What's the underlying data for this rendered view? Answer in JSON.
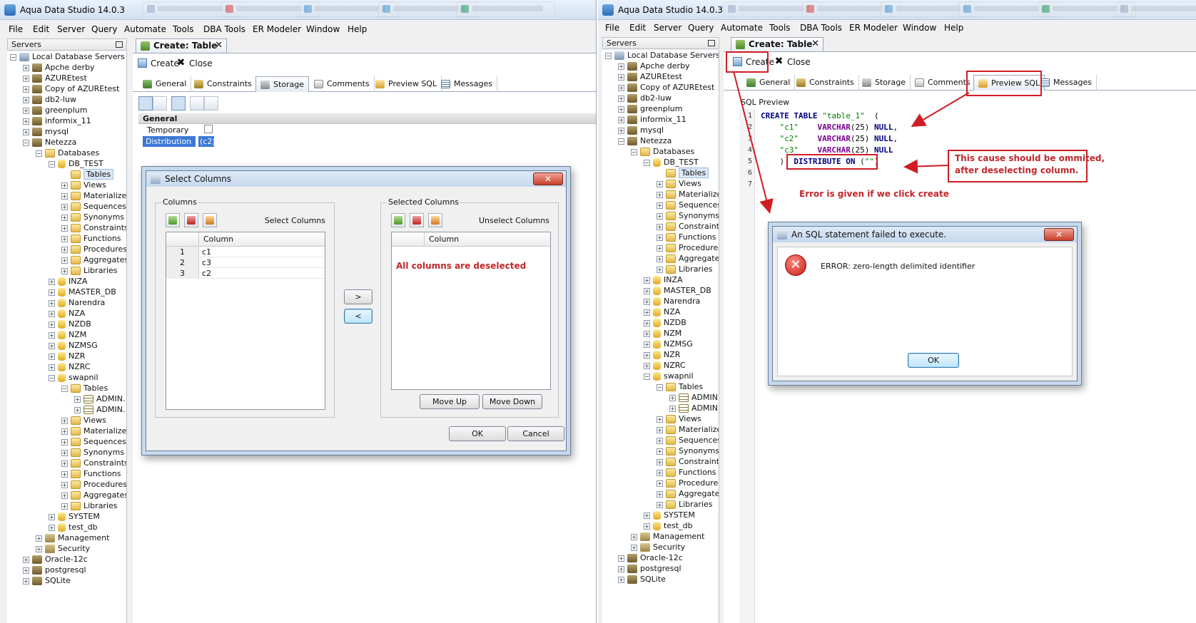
{
  "app_title": "Aqua Data Studio 14.0.3",
  "menu": [
    "File",
    "Edit",
    "Server",
    "Query",
    "Automate",
    "Tools",
    "DBA Tools",
    "ER Modeler",
    "Window",
    "Help"
  ],
  "servers_panel": {
    "title": "Servers"
  },
  "tree": {
    "left": [
      {
        "label": "Local Database Servers",
        "indent": 0,
        "exp": "-",
        "icon": "server-local"
      },
      {
        "label": "Apche derby",
        "indent": 1,
        "exp": "+",
        "icon": "server"
      },
      {
        "label": "AZUREtest",
        "indent": 1,
        "exp": "+",
        "icon": "server"
      },
      {
        "label": "Copy of AZUREtest",
        "indent": 1,
        "exp": "+",
        "icon": "server"
      },
      {
        "label": "db2-luw",
        "indent": 1,
        "exp": "+",
        "icon": "server"
      },
      {
        "label": "greenplum",
        "indent": 1,
        "exp": "+",
        "icon": "server"
      },
      {
        "label": "informix_11",
        "indent": 1,
        "exp": "+",
        "icon": "server"
      },
      {
        "label": "mysql",
        "indent": 1,
        "exp": "+",
        "icon": "server"
      },
      {
        "label": "Netezza",
        "indent": 1,
        "exp": "-",
        "icon": "server"
      },
      {
        "label": "Databases",
        "indent": 2,
        "exp": "-",
        "icon": "folder"
      },
      {
        "label": "DB_TEST",
        "indent": 3,
        "exp": "-",
        "icon": "db"
      },
      {
        "label": "Tables",
        "indent": 4,
        "exp": "",
        "icon": "folder",
        "selected": true
      },
      {
        "label": "Views",
        "indent": 4,
        "exp": "+",
        "icon": "folder"
      },
      {
        "label": "Materialized",
        "indent": 4,
        "exp": "+",
        "icon": "folder"
      },
      {
        "label": "Sequences",
        "indent": 4,
        "exp": "+",
        "icon": "folder"
      },
      {
        "label": "Synonyms",
        "indent": 4,
        "exp": "+",
        "icon": "folder"
      },
      {
        "label": "Constraints",
        "indent": 4,
        "exp": "+",
        "icon": "folder"
      },
      {
        "label": "Functions",
        "indent": 4,
        "exp": "+",
        "icon": "folder"
      },
      {
        "label": "Procedures",
        "indent": 4,
        "exp": "+",
        "icon": "folder"
      },
      {
        "label": "Aggregates",
        "indent": 4,
        "exp": "+",
        "icon": "folder"
      },
      {
        "label": "Libraries",
        "indent": 4,
        "exp": "+",
        "icon": "folder"
      },
      {
        "label": "INZA",
        "indent": 3,
        "exp": "+",
        "icon": "db"
      },
      {
        "label": "MASTER_DB",
        "indent": 3,
        "exp": "+",
        "icon": "db"
      },
      {
        "label": "Narendra",
        "indent": 3,
        "exp": "+",
        "icon": "db"
      },
      {
        "label": "NZA",
        "indent": 3,
        "exp": "+",
        "icon": "db"
      },
      {
        "label": "NZDB",
        "indent": 3,
        "exp": "+",
        "icon": "db"
      },
      {
        "label": "NZM",
        "indent": 3,
        "exp": "+",
        "icon": "db"
      },
      {
        "label": "NZMSG",
        "indent": 3,
        "exp": "+",
        "icon": "db"
      },
      {
        "label": "NZR",
        "indent": 3,
        "exp": "+",
        "icon": "db"
      },
      {
        "label": "NZRC",
        "indent": 3,
        "exp": "+",
        "icon": "db"
      },
      {
        "label": "swapnil",
        "indent": 3,
        "exp": "-",
        "icon": "db"
      },
      {
        "label": "Tables",
        "indent": 4,
        "exp": "-",
        "icon": "folder"
      },
      {
        "label": "ADMIN.",
        "indent": 5,
        "exp": "+",
        "icon": "table"
      },
      {
        "label": "ADMIN.",
        "indent": 5,
        "exp": "+",
        "icon": "table"
      },
      {
        "label": "Views",
        "indent": 4,
        "exp": "+",
        "icon": "folder"
      },
      {
        "label": "Materialized",
        "indent": 4,
        "exp": "+",
        "icon": "folder"
      },
      {
        "label": "Sequences",
        "indent": 4,
        "exp": "+",
        "icon": "folder"
      },
      {
        "label": "Synonyms",
        "indent": 4,
        "exp": "+",
        "icon": "folder"
      },
      {
        "label": "Constraints",
        "indent": 4,
        "exp": "+",
        "icon": "folder"
      },
      {
        "label": "Functions",
        "indent": 4,
        "exp": "+",
        "icon": "folder"
      },
      {
        "label": "Procedures",
        "indent": 4,
        "exp": "+",
        "icon": "folder"
      },
      {
        "label": "Aggregates",
        "indent": 4,
        "exp": "+",
        "icon": "folder"
      },
      {
        "label": "Libraries",
        "indent": 4,
        "exp": "+",
        "icon": "folder"
      },
      {
        "label": "SYSTEM",
        "indent": 3,
        "exp": "+",
        "icon": "db"
      },
      {
        "label": "test_db",
        "indent": 3,
        "exp": "+",
        "icon": "db"
      },
      {
        "label": "Management",
        "indent": 2,
        "exp": "+",
        "icon": "mgmt"
      },
      {
        "label": "Security",
        "indent": 2,
        "exp": "+",
        "icon": "mgmt"
      },
      {
        "label": "Oracle-12c",
        "indent": 1,
        "exp": "+",
        "icon": "server"
      },
      {
        "label": "postgresql",
        "indent": 1,
        "exp": "+",
        "icon": "server"
      },
      {
        "label": "SQLite",
        "indent": 1,
        "exp": "+",
        "icon": "server"
      }
    ]
  },
  "editor": {
    "doc_tab": "Create: Table",
    "toolbar": {
      "create": "Create",
      "close": "Close"
    },
    "subtabs": [
      "General",
      "Constraints",
      "Storage",
      "Comments",
      "Preview SQL",
      "Messages"
    ]
  },
  "properties": {
    "section": "General",
    "rows": [
      {
        "name": "Temporary",
        "value": ""
      },
      {
        "name": "Distribution",
        "value": "(c2)"
      }
    ]
  },
  "select_columns_dialog": {
    "title": "Select Columns",
    "columns_group": "Columns",
    "select_label": "Select Columns",
    "selected_group": "Selected Columns",
    "unselect_label": "Unselect Columns",
    "column_header": "Column",
    "columns": [
      {
        "num": "1",
        "name": "c1"
      },
      {
        "num": "2",
        "name": "c3"
      },
      {
        "num": "3",
        "name": "c2"
      }
    ],
    "move_right": ">",
    "move_left": "<",
    "move_up": "Move Up",
    "move_down": "Move Down",
    "ok": "OK",
    "cancel": "Cancel"
  },
  "sql_preview": {
    "label": "SQL Preview",
    "line_numbers": [
      "1",
      "2",
      "3",
      "4",
      "5",
      "6",
      "7"
    ]
  },
  "error_dialog": {
    "title": "An SQL statement failed to execute.",
    "message": "ERROR:  zero-length delimited identifier",
    "ok": "OK"
  },
  "annotations": {
    "all_deselected": "All columns are deselected",
    "cause_line1": "This cause should be ommited,",
    "cause_line2": "after deselecting column.",
    "error_note": "Error is given if we click create"
  },
  "colors": {
    "annotation_red": "#c0282c",
    "keyword": "#000080",
    "string": "#008000",
    "type": "#7a0090"
  }
}
